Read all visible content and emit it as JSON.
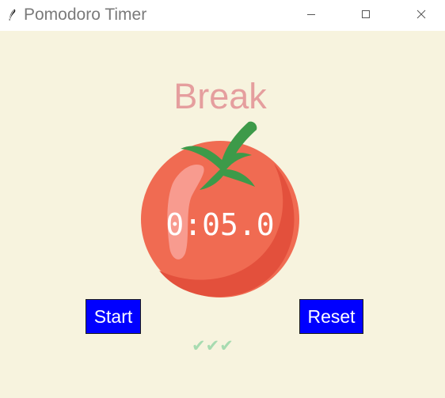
{
  "window": {
    "title": "Pomodoro Timer",
    "app_icon": "feather-icon",
    "controls": {
      "minimize": "minimize-icon",
      "maximize": "maximize-icon",
      "close": "close-icon"
    }
  },
  "timer": {
    "mode_label": "Break",
    "time_display": "0:05.0",
    "image": "tomato-icon"
  },
  "buttons": {
    "start_label": "Start",
    "reset_label": "Reset"
  },
  "progress": {
    "checkmarks": "✔✔✔",
    "completed_sessions": 3
  },
  "colors": {
    "background": "#f7f3de",
    "mode_label": "#e59e9e",
    "button_bg": "#0000ff",
    "button_text": "#ffffff",
    "checkmark": "#a7dbb0",
    "tomato": "#f2634a",
    "leaf": "#3d9a49"
  }
}
